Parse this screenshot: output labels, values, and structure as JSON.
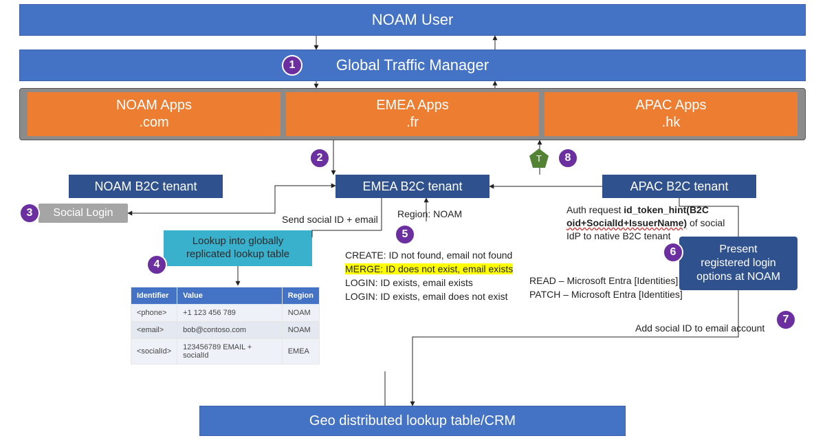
{
  "top": {
    "user_box": "NOAM User",
    "gtm_box": "Global Traffic Manager"
  },
  "apps": {
    "noam_line1": "NOAM Apps",
    "noam_line2": ".com",
    "emea_line1": "EMEA Apps",
    "emea_line2": ".fr",
    "apac_line1": "APAC Apps",
    "apac_line2": ".hk"
  },
  "tenants": {
    "noam": "NOAM B2C tenant",
    "emea": "EMEA B2C tenant",
    "apac": "APAC B2C tenant"
  },
  "social_login": "Social Login",
  "lookup_box_line1": "Lookup into globally",
  "lookup_box_line2": "replicated lookup table",
  "present_box_line1": "Present",
  "present_box_line2": "registered login",
  "present_box_line3": "options at NOAM",
  "bottom_box": "Geo distributed lookup table/CRM",
  "labels": {
    "send_social": "Send social ID + email",
    "region": "Region: NOAM",
    "create": "CREATE: ID not found, email not found",
    "merge": "MERGE: ID does not exist, email exists",
    "login1": "LOGIN: ID exists, email exists",
    "login2": "LOGIN: ID exists, email does not exist",
    "auth_line1_a": "Auth request ",
    "auth_line1_b": "id_token_hint(B2C",
    "auth_line2": "oid+SocialId+IssuerName)",
    "auth_line2_tail": " of social",
    "auth_line3": "IdP to native B2C tenant",
    "read": "READ – Microsoft Entra [Identities]",
    "patch": "PATCH – Microsoft Entra [Identities]",
    "add_social": "Add social ID to email account"
  },
  "table": {
    "h1": "Identifier",
    "h2": "Value",
    "h3": "Region",
    "r1c1": "<phone>",
    "r1c2": "+1 123 456 789",
    "r1c3": "NOAM",
    "r2c1": "<email>",
    "r2c2": "bob@contoso.com",
    "r2c3": "NOAM",
    "r3c1": "<socialId>",
    "r3c2": "123456789 EMAIL + socialId",
    "r3c3": "EMEA"
  },
  "badges": {
    "b1": "1",
    "b2": "2",
    "b3": "3",
    "b4": "4",
    "b5": "5",
    "b6": "6",
    "b7": "7",
    "b8": "8",
    "t": "T"
  }
}
